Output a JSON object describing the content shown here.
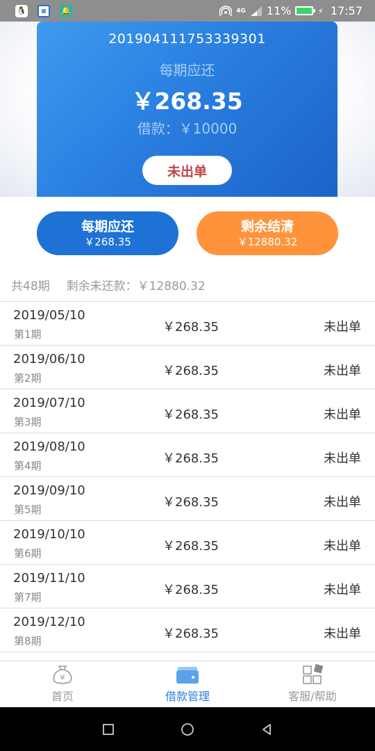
{
  "status_bar": {
    "signal_label": "4G",
    "battery": "11%",
    "time": "17:57"
  },
  "card": {
    "order_no": "201904111753339301",
    "per_label": "每期应还",
    "per_amount": "￥268.35",
    "loan_amount": "借款：￥10000",
    "status": "未出单"
  },
  "actions": {
    "per_title": "每期应还",
    "per_value": "￥268.35",
    "rest_title": "剩余结清",
    "rest_value": "￥12880.32"
  },
  "summary": {
    "total_periods": "共48期",
    "remaining": "剩余未还款：￥12880.32"
  },
  "schedule": [
    {
      "date": "2019/05/10",
      "period": "第1期",
      "amount": "￥268.35",
      "status": "未出单"
    },
    {
      "date": "2019/06/10",
      "period": "第2期",
      "amount": "￥268.35",
      "status": "未出单"
    },
    {
      "date": "2019/07/10",
      "period": "第3期",
      "amount": "￥268.35",
      "status": "未出单"
    },
    {
      "date": "2019/08/10",
      "period": "第4期",
      "amount": "￥268.35",
      "status": "未出单"
    },
    {
      "date": "2019/09/10",
      "period": "第5期",
      "amount": "￥268.35",
      "status": "未出单"
    },
    {
      "date": "2019/10/10",
      "period": "第6期",
      "amount": "￥268.35",
      "status": "未出单"
    },
    {
      "date": "2019/11/10",
      "period": "第7期",
      "amount": "￥268.35",
      "status": "未出单"
    },
    {
      "date": "2019/12/10",
      "period": "第8期",
      "amount": "￥268.35",
      "status": "未出单"
    }
  ],
  "nav": {
    "home": "首页",
    "loans": "借款管理",
    "help": "客服/帮助"
  },
  "colors": {
    "accent_blue": "#2a7fe0",
    "accent_orange": "#ff933b",
    "status_red": "#c1464a"
  }
}
